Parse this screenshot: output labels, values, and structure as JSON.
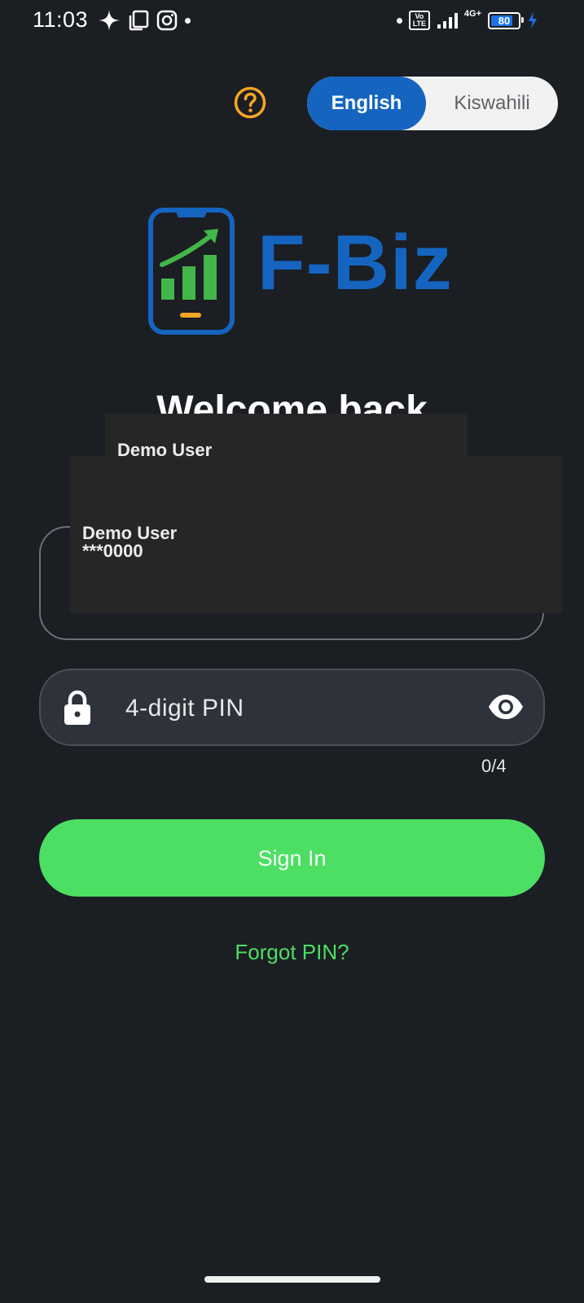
{
  "status_bar": {
    "time": "11:03",
    "left_icons": [
      "sparkle-icon",
      "copy-icon",
      "instagram-icon",
      "notification-dot"
    ],
    "volte": "Vo LTE",
    "network": "4G+",
    "battery": "80",
    "battery_level": 0.8,
    "charging": true
  },
  "header": {
    "help_icon": "help-circle-icon",
    "language_options": [
      "English",
      "Kiswahili"
    ],
    "selected_language": "English"
  },
  "logo": {
    "text": "F-Biz",
    "icon": "phone-growth-chart-icon"
  },
  "welcome": {
    "title": "Welcome back"
  },
  "autofill_popup_small": {
    "name": "Demo User"
  },
  "autofill_popup_large": {
    "name": "Demo User",
    "number": "***0000"
  },
  "pin_field": {
    "placeholder": "4-digit PIN",
    "value": "",
    "counter": "0/4",
    "left_icon": "lock-icon",
    "right_icon": "eye-icon"
  },
  "actions": {
    "sign_in": "Sign In",
    "forgot_pin": "Forgot PIN?"
  },
  "colors": {
    "background": "#1b1e23",
    "primary_blue": "#1565c0",
    "green": "#4cdf63",
    "help_orange": "#f5a623"
  }
}
